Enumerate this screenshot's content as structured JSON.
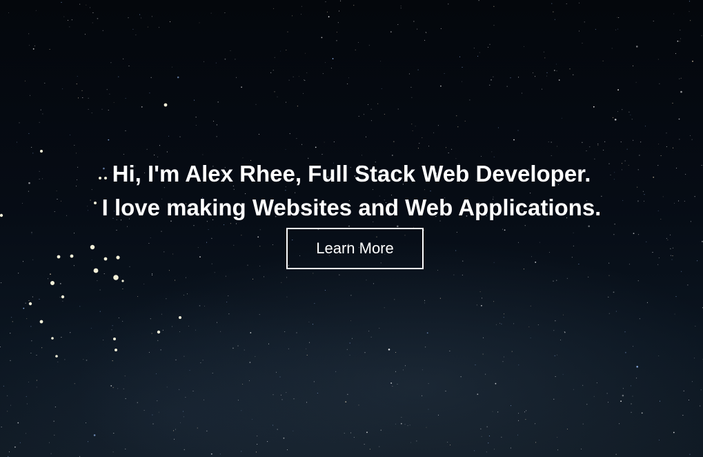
{
  "hero": {
    "headline_line_1": "Hi, I'm Alex Rhee, Full Stack Web Developer.",
    "headline_line_2": "I love making Websites and Web Applications.",
    "cta_label": "Learn More"
  },
  "colors": {
    "text": "#ffffff",
    "background": "#05090f",
    "button_border": "#ffffff"
  }
}
